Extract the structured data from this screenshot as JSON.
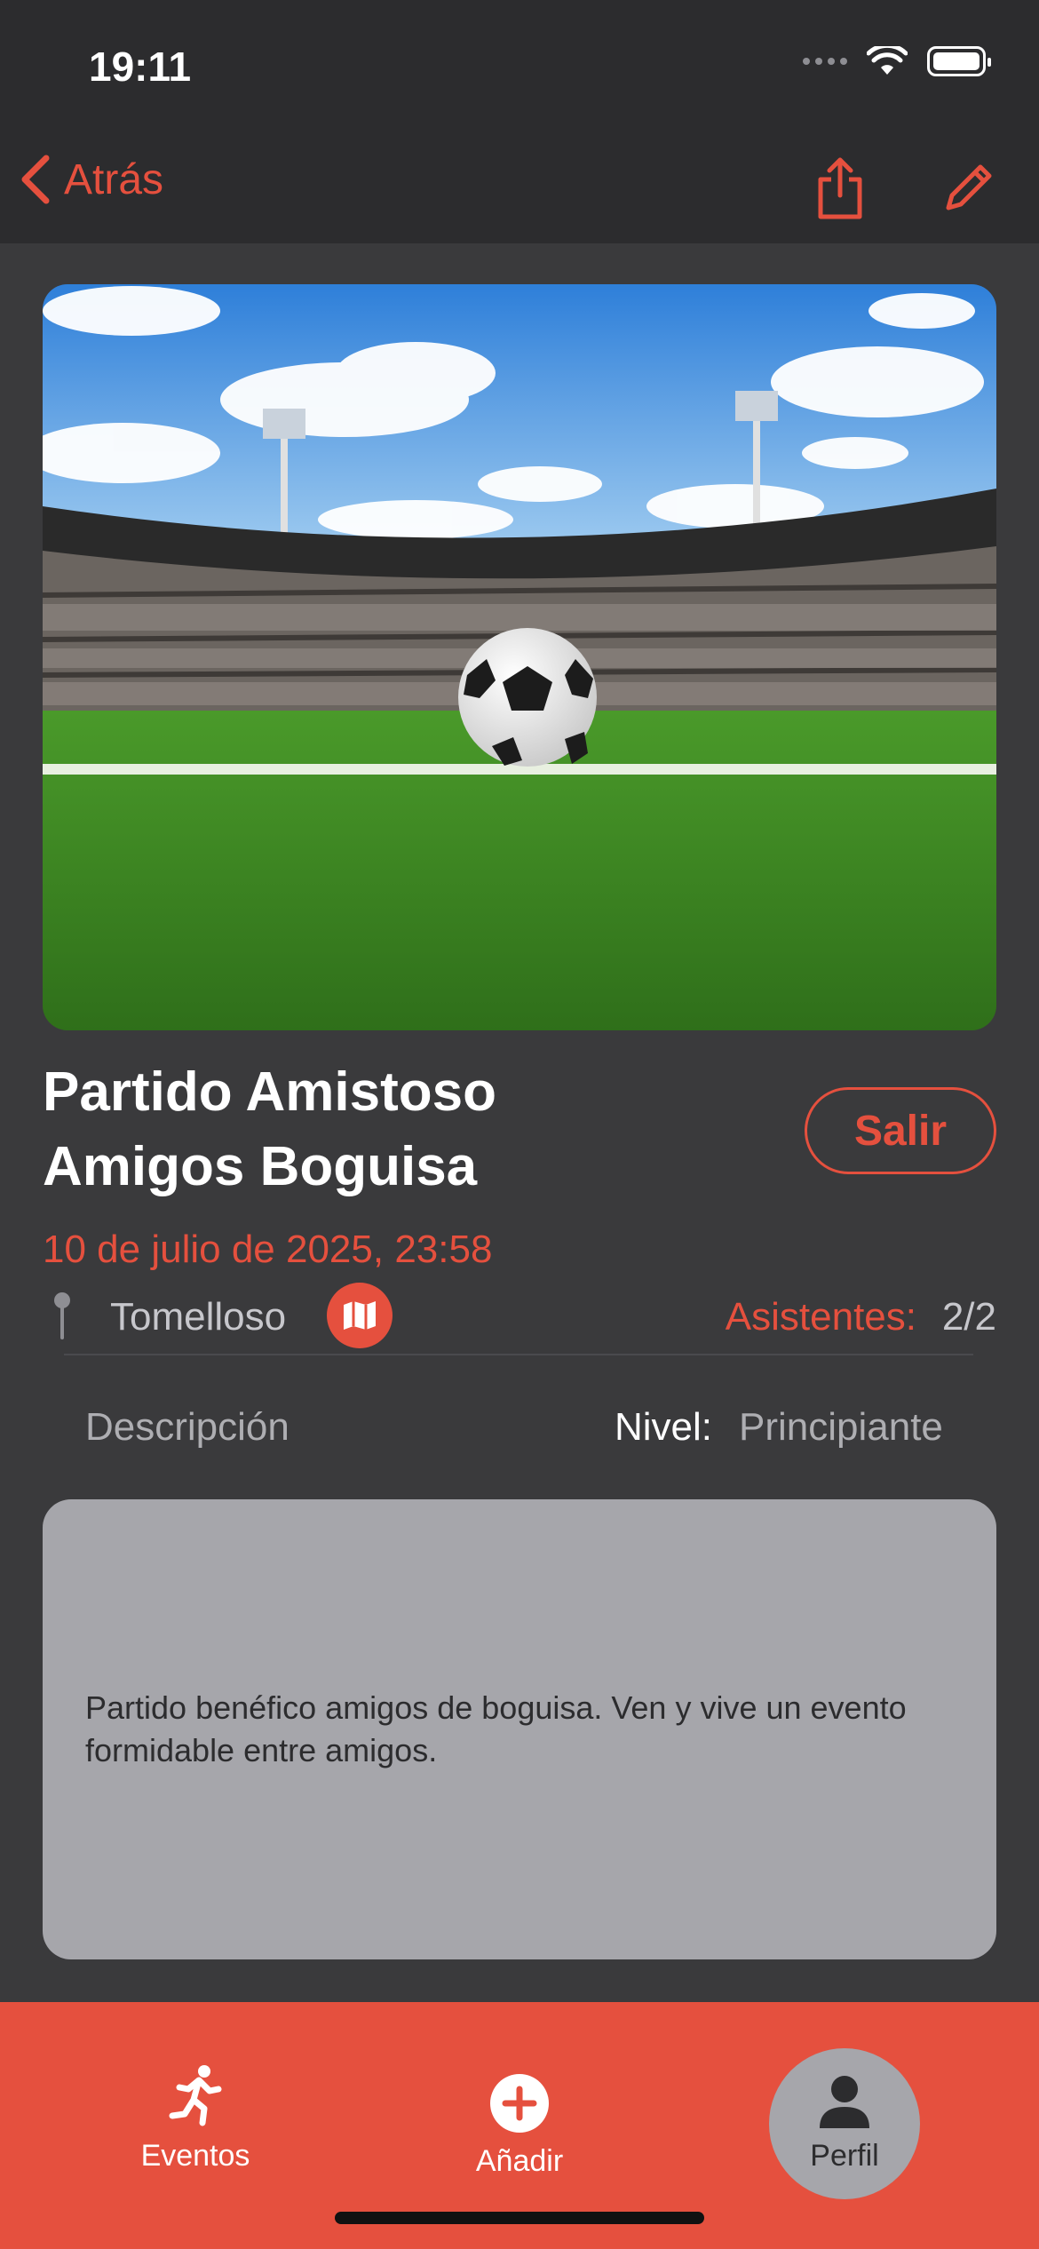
{
  "status": {
    "time": "19:11"
  },
  "nav": {
    "back_label": "Atrás"
  },
  "event": {
    "title": "Partido Amistoso Amigos Boguisa",
    "leave_label": "Salir",
    "datetime": "10 de julio de 2025, 23:58",
    "location": "Tomelloso",
    "attendees_label": "Asistentes:",
    "attendees_value": "2/2",
    "description_label": "Descripción",
    "level_label": "Nivel:",
    "level_value": "Principiante",
    "description": "Partido benéfico amigos de boguisa. Ven y vive un evento formidable entre amigos."
  },
  "tabs": [
    {
      "label": "Eventos",
      "icon": "running-icon"
    },
    {
      "label": "Añadir",
      "icon": "plus-circle-icon"
    },
    {
      "label": "Perfil",
      "icon": "person-icon"
    }
  ],
  "colors": {
    "accent": "#e5503e",
    "background": "#3a3a3c",
    "bar": "#2c2c2e",
    "description_box": "#a6a6ab"
  }
}
